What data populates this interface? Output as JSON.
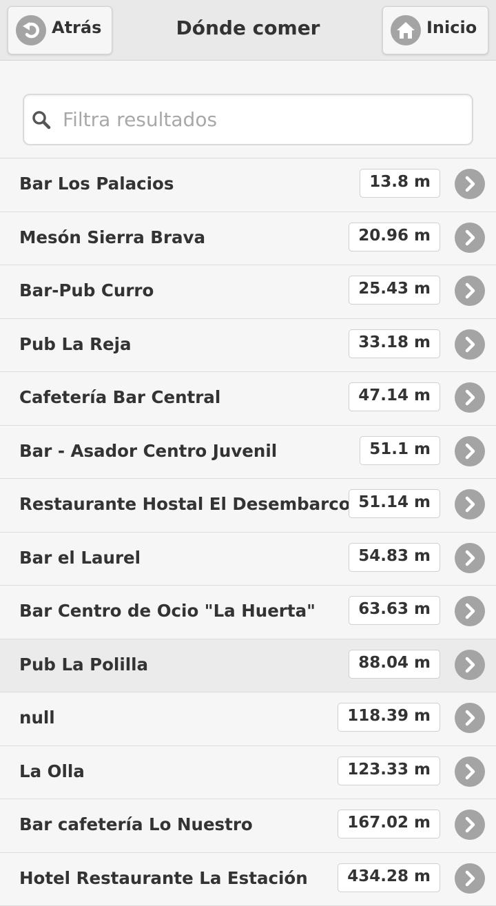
{
  "header": {
    "back_label": "Atrás",
    "title": "Dónde comer",
    "home_label": "Inicio"
  },
  "search": {
    "placeholder": "Filtra resultados",
    "value": ""
  },
  "restaurants": [
    {
      "name": "Bar Los Palacios",
      "distance": "13.8 m"
    },
    {
      "name": "Mesón Sierra Brava",
      "distance": "20.96 m"
    },
    {
      "name": "Bar-Pub Curro",
      "distance": "25.43 m"
    },
    {
      "name": "Pub La Reja",
      "distance": "33.18 m"
    },
    {
      "name": "Cafetería Bar Central",
      "distance": "47.14 m"
    },
    {
      "name": "Bar - Asador Centro Juvenil",
      "distance": "51.1 m"
    },
    {
      "name": "Restaurante Hostal El Desembarco",
      "distance": "51.14 m"
    },
    {
      "name": "Bar el Laurel",
      "distance": "54.83 m"
    },
    {
      "name": "Bar Centro de Ocio \"La Huerta\"",
      "distance": "63.63 m"
    },
    {
      "name": "Pub La Polilla",
      "distance": "88.04 m"
    },
    {
      "name": "null",
      "distance": "118.39 m"
    },
    {
      "name": "La Olla",
      "distance": "123.33 m"
    },
    {
      "name": "Bar cafetería Lo Nuestro",
      "distance": "167.02 m"
    },
    {
      "name": "Hotel Restaurante La Estación",
      "distance": "434.28 m"
    }
  ],
  "icons": {
    "back": "back-arrow-icon",
    "home": "home-icon",
    "search": "search-icon",
    "row_arrow": "chevron-right-icon"
  },
  "colors": {
    "header_bg": "#e9e9e9",
    "icon_circle": "#a4a4a4",
    "text": "#333333",
    "active_row": "#ebebeb"
  }
}
